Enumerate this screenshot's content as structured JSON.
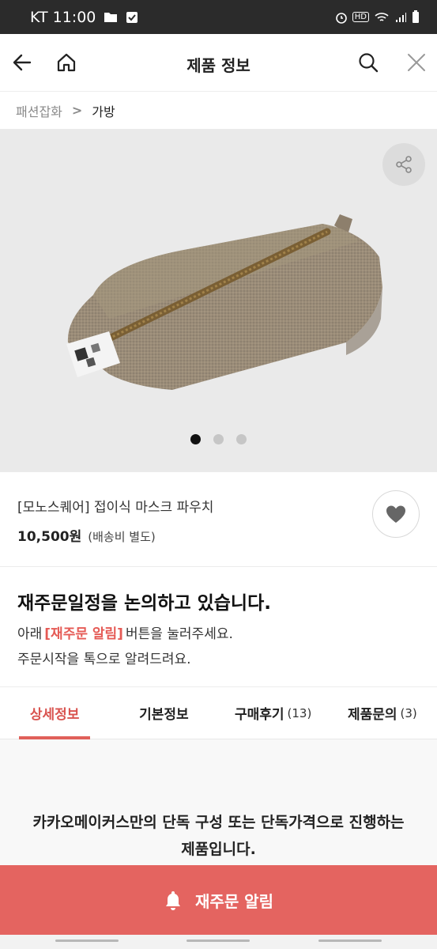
{
  "status_bar": {
    "carrier_time": "KT 11:00",
    "icons": [
      "folder-icon",
      "checkbox-icon",
      "alarm-icon",
      "hd-icon",
      "wifi-icon",
      "signal-icon",
      "battery-icon"
    ],
    "hd_label": "HD"
  },
  "header": {
    "title": "제품 정보",
    "icons": [
      "back-arrow-icon",
      "home-icon",
      "search-icon",
      "close-icon"
    ]
  },
  "breadcrumb": {
    "parent": "패션잡화",
    "separator": ">",
    "current": "가방"
  },
  "gallery": {
    "share_icon": "share-icon",
    "dots_total": 3,
    "active_dot": 1
  },
  "product": {
    "name": "[모노스퀘어] 접이식 마스크 파우치",
    "price": "10,500원",
    "shipping_note": "(배송비 별도)",
    "like_icon": "heart-icon"
  },
  "restock_notice": {
    "title": "재주문일정을 논의하고 있습니다.",
    "line1_prefix": "아래",
    "line1_highlight": "[재주문 알림]",
    "line1_suffix": "버튼을 눌러주세요.",
    "line2": "주문시작을 톡으로 알려드려요."
  },
  "tabs": [
    {
      "label": "상세정보",
      "count": ""
    },
    {
      "label": "기본정보",
      "count": ""
    },
    {
      "label": "구매후기",
      "count": "(13)"
    },
    {
      "label": "제품문의",
      "count": "(3)"
    }
  ],
  "detail": {
    "text": "카카오메이커스만의 단독 구성 또는 단독가격으로 진행하는 제품입니다."
  },
  "cta": {
    "label": "재주문 알림",
    "icon": "bell-icon"
  },
  "colors": {
    "accent": "#e46460",
    "active_tab": "#d9534f",
    "status_bar": "#2b2b2b"
  }
}
